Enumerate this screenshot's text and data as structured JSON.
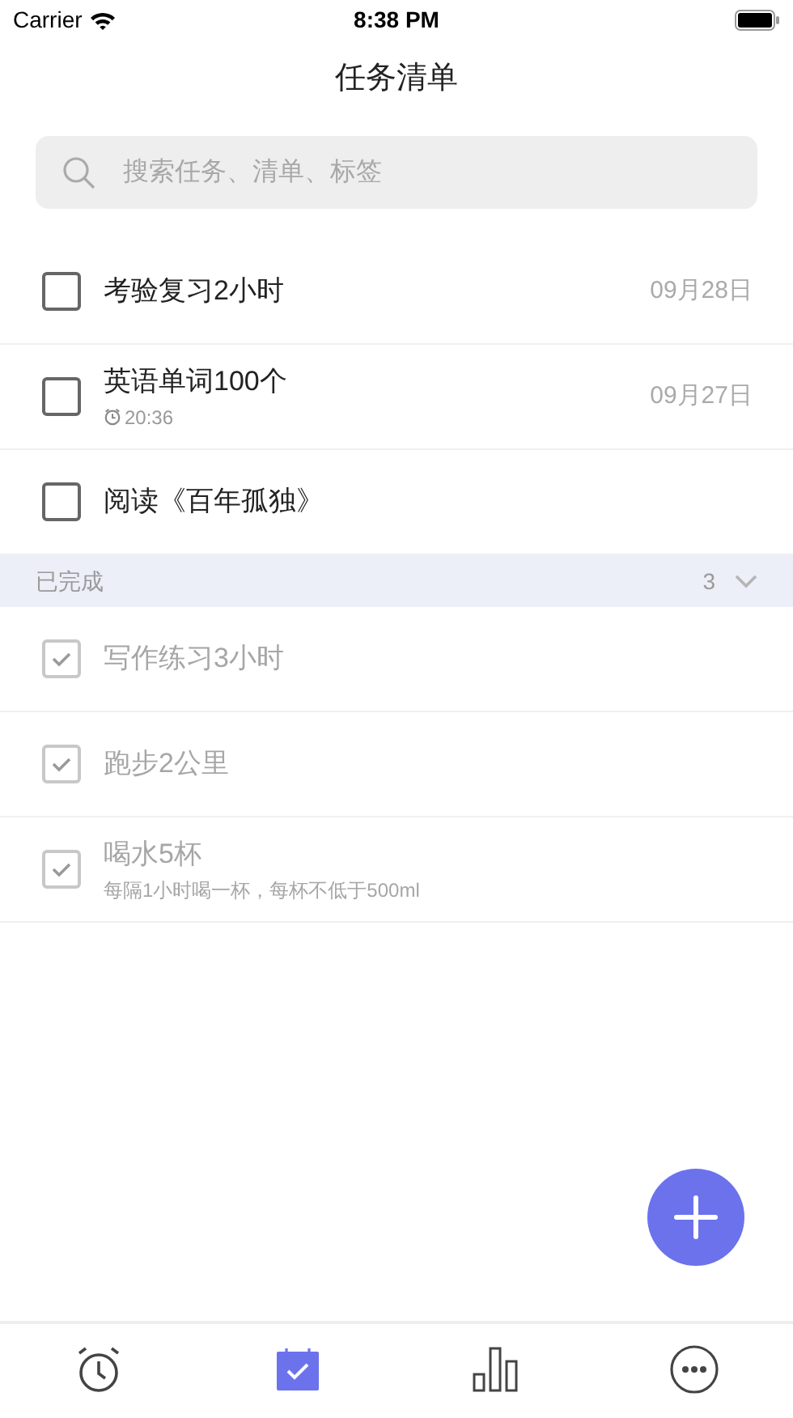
{
  "status_bar": {
    "carrier": "Carrier",
    "time": "8:38 PM"
  },
  "title": "任务清单",
  "search": {
    "placeholder": "搜索任务、清单、标签"
  },
  "tasks": [
    {
      "title": "考验复习2小时",
      "date": "09月28日",
      "checked": false
    },
    {
      "title": "英语单词100个",
      "reminder": "20:36",
      "date": "09月27日",
      "checked": false
    },
    {
      "title": "阅读《百年孤独》",
      "checked": false
    }
  ],
  "completed_section": {
    "label": "已完成",
    "count": "3",
    "expanded": true,
    "tasks": [
      {
        "title": "写作练习3小时",
        "checked": true
      },
      {
        "title": "跑步2公里",
        "checked": true
      },
      {
        "title": "喝水5杯",
        "note": "每隔1小时喝一杯，每杯不低于500ml",
        "checked": true
      }
    ]
  },
  "tab_bar": [
    {
      "kind": "alarm",
      "selected": false
    },
    {
      "kind": "calendar",
      "selected": true
    },
    {
      "kind": "stats",
      "selected": false
    },
    {
      "kind": "more",
      "selected": false
    }
  ]
}
